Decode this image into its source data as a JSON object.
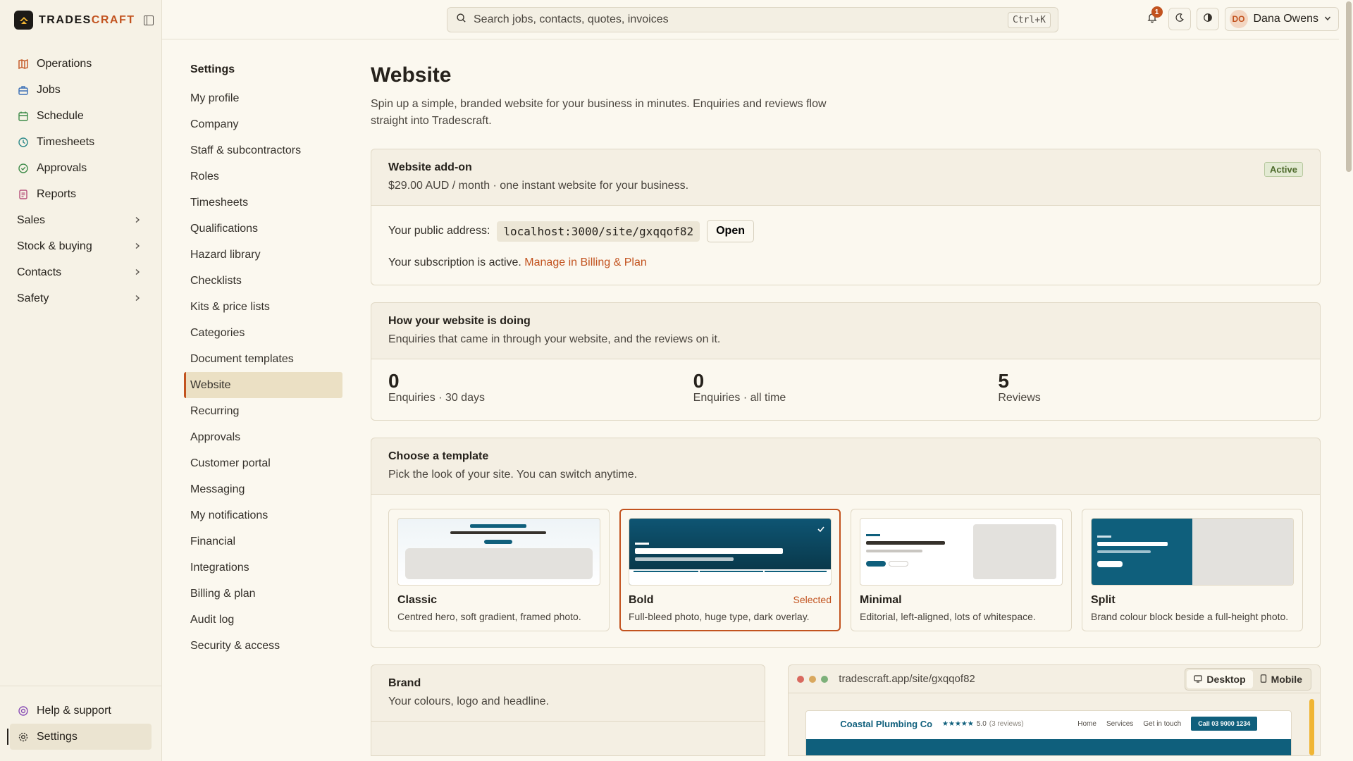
{
  "app": {
    "name_part1": "TRADES",
    "name_part2": "CRAFT"
  },
  "sidebar": {
    "items": [
      {
        "label": "Operations",
        "icon": "map-icon",
        "color": "#c2531f"
      },
      {
        "label": "Jobs",
        "icon": "briefcase-icon",
        "color": "#3b6fb6"
      },
      {
        "label": "Schedule",
        "icon": "calendar-icon",
        "color": "#3f8c4a"
      },
      {
        "label": "Timesheets",
        "icon": "clock-icon",
        "color": "#2d8a8a"
      },
      {
        "label": "Approvals",
        "icon": "check-circle-icon",
        "color": "#3f8c4a"
      },
      {
        "label": "Reports",
        "icon": "report-icon",
        "color": "#b64f7a"
      },
      {
        "label": "Sales"
      },
      {
        "label": "Stock & buying"
      },
      {
        "label": "Contacts"
      },
      {
        "label": "Safety"
      }
    ],
    "bottom": [
      {
        "label": "Help & support",
        "icon": "help-icon",
        "color": "#8a4fb6"
      },
      {
        "label": "Settings",
        "icon": "gear-icon",
        "color": "#35312b"
      }
    ]
  },
  "topbar": {
    "search_placeholder": "Search jobs, contacts, quotes, invoices",
    "shortcut": "Ctrl+K",
    "notification_count": "1",
    "user_initials": "DO",
    "user_name": "Dana Owens"
  },
  "settings_nav": {
    "title": "Settings",
    "items": [
      "My profile",
      "Company",
      "Staff & subcontractors",
      "Roles",
      "Timesheets",
      "Qualifications",
      "Hazard library",
      "Checklists",
      "Kits & price lists",
      "Categories",
      "Document templates",
      "Website",
      "Recurring",
      "Approvals",
      "Customer portal",
      "Messaging",
      "My notifications",
      "Financial",
      "Integrations",
      "Billing & plan",
      "Audit log",
      "Security & access"
    ],
    "active": "Website"
  },
  "page": {
    "title": "Website",
    "lede": "Spin up a simple, branded website for your business in minutes. Enquiries and reviews flow straight into Tradescraft."
  },
  "addon": {
    "title": "Website add-on",
    "price": "$29.00 AUD / month · one instant website for your business.",
    "status": "Active",
    "address_label": "Your public address:",
    "address": "localhost:3000/site/gxqqof82",
    "open_label": "Open",
    "sub_text": "Your subscription is active.",
    "manage_link": "Manage in Billing & Plan"
  },
  "stats": {
    "title": "How your website is doing",
    "subtitle": "Enquiries that came in through your website, and the reviews on it.",
    "items": [
      {
        "value": "0",
        "label": "Enquiries · 30 days"
      },
      {
        "value": "0",
        "label": "Enquiries · all time"
      },
      {
        "value": "5",
        "label": "Reviews"
      }
    ]
  },
  "templates": {
    "title": "Choose a template",
    "subtitle": "Pick the look of your site. You can switch anytime.",
    "selected_label": "Selected",
    "items": [
      {
        "name": "Classic",
        "desc": "Centred hero, soft gradient, framed photo."
      },
      {
        "name": "Bold",
        "desc": "Full-bleed photo, huge type, dark overlay."
      },
      {
        "name": "Minimal",
        "desc": "Editorial, left-aligned, lots of whitespace."
      },
      {
        "name": "Split",
        "desc": "Brand colour block beside a full-height photo."
      }
    ]
  },
  "brand": {
    "title": "Brand",
    "subtitle": "Your colours, logo and headline."
  },
  "preview": {
    "url": "tradescraft.app/site/gxqqof82",
    "desktop_label": "Desktop",
    "mobile_label": "Mobile",
    "site_name": "Coastal Plumbing Co",
    "rating": "★★★★★",
    "rating_text": "5.0",
    "reviews_text": "(3 reviews)",
    "nav": [
      "Home",
      "Services",
      "Get in touch"
    ],
    "cta": "Call 03 9000 1234"
  },
  "colors": {
    "accent": "#c2531f",
    "brand_teal": "#0f5f7c",
    "success": "#4f6b2d"
  }
}
